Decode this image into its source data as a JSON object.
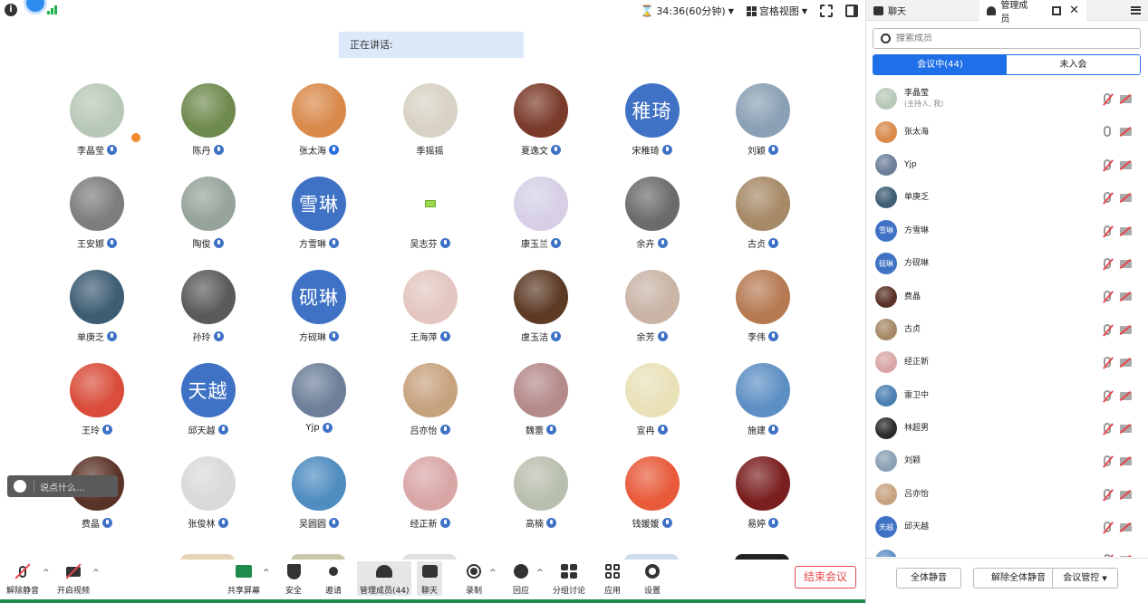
{
  "topbar": {
    "timer": "34:36(60分钟)",
    "view_mode": "宫格视图"
  },
  "speaking_label": "正在讲话:",
  "participants": [
    {
      "name": "李晶莹",
      "avatar": "photo",
      "color": "#b8c8b8",
      "host": true
    },
    {
      "name": "陈丹",
      "avatar": "photo",
      "color": "#6f8a4e"
    },
    {
      "name": "张太海",
      "avatar": "photo",
      "color": "#d9894a",
      "mic_on": true
    },
    {
      "name": "季摇摇",
      "avatar": "photo",
      "color": "#d8d2c4",
      "no_badge": true
    },
    {
      "name": "夏逸文",
      "avatar": "photo",
      "color": "#7a3b2a"
    },
    {
      "name": "宋稚琦",
      "avatar": "text",
      "text": "稚琦"
    },
    {
      "name": "刘颖",
      "avatar": "photo",
      "color": "#8aa0b4"
    },
    {
      "name": "王安娜",
      "avatar": "photo",
      "color": "#7d7d7d"
    },
    {
      "name": "陶俊",
      "avatar": "photo",
      "color": "#95a39a"
    },
    {
      "name": "方雪琳",
      "avatar": "text",
      "text": "雪琳"
    },
    {
      "name": "吴志芬",
      "avatar": "blank"
    },
    {
      "name": "康玉兰",
      "avatar": "photo",
      "color": "#d6cfe6"
    },
    {
      "name": "余卉",
      "avatar": "photo",
      "color": "#6b6b6b"
    },
    {
      "name": "古贞",
      "avatar": "photo",
      "color": "#a68966"
    },
    {
      "name": "单庚乏",
      "avatar": "photo",
      "color": "#3d5d73"
    },
    {
      "name": "孙玲",
      "avatar": "photo",
      "color": "#5a5a5a"
    },
    {
      "name": "方砚琳",
      "avatar": "text",
      "text": "砚琳"
    },
    {
      "name": "王海萍",
      "avatar": "photo",
      "color": "#e3c6c0"
    },
    {
      "name": "虞玉洁",
      "avatar": "photo",
      "color": "#5c3a24"
    },
    {
      "name": "余芳",
      "avatar": "photo",
      "color": "#c9b4a6"
    },
    {
      "name": "李伟",
      "avatar": "photo",
      "color": "#b67a53"
    },
    {
      "name": "王玲",
      "avatar": "photo",
      "color": "#d94d3a"
    },
    {
      "name": "邱天越",
      "avatar": "text",
      "text": "天越"
    },
    {
      "name": "Yjp",
      "avatar": "photo",
      "color": "#6d7f99"
    },
    {
      "name": "吕亦怡",
      "avatar": "photo",
      "color": "#c7a27f"
    },
    {
      "name": "魏蕾",
      "avatar": "photo",
      "color": "#b58a8a"
    },
    {
      "name": "宣冉",
      "avatar": "photo",
      "color": "#e9e1b8"
    },
    {
      "name": "施建",
      "avatar": "photo",
      "color": "#5d8fc4"
    },
    {
      "name": "费晶",
      "avatar": "photo",
      "color": "#5a3328"
    },
    {
      "name": "张俊林",
      "avatar": "photo",
      "color": "#d9d9d9"
    },
    {
      "name": "吴圆圆",
      "avatar": "photo",
      "color": "#4f8cc0"
    },
    {
      "name": "经正新",
      "avatar": "photo",
      "color": "#d9a6a6"
    },
    {
      "name": "高楠",
      "avatar": "photo",
      "color": "#b9bfae"
    },
    {
      "name": "钱媛媛",
      "avatar": "photo",
      "color": "#e85a3a"
    },
    {
      "name": "易婷",
      "avatar": "photo",
      "color": "#7a1f1f"
    }
  ],
  "chat_input": {
    "placeholder": "说点什么..."
  },
  "toolbar": {
    "unmute": "解除静音",
    "start_video": "开启视频",
    "share_screen": "共享屏幕",
    "security": "安全",
    "invite": "邀请",
    "manage_members": "管理成员(44)",
    "chat": "聊天",
    "record": "录制",
    "reactions": "回应",
    "breakout": "分组讨论",
    "apps": "应用",
    "settings": "设置",
    "end_meeting": "结束会议"
  },
  "panel": {
    "tab_chat": "聊天",
    "tab_members": "管理成员",
    "search_placeholder": "搜索成员",
    "seg_in_meeting": "会议中(44)",
    "seg_not_joined": "未入会",
    "members": [
      {
        "name": "李晶莹",
        "sub": "(主持人, 我)",
        "avatar": "photo",
        "color": "#b8c8b8",
        "mic_muted": true
      },
      {
        "name": "张太海",
        "avatar": "photo",
        "color": "#d9894a",
        "mic_muted": false
      },
      {
        "name": "Yjp",
        "avatar": "photo",
        "color": "#6d7f99",
        "mic_muted": true
      },
      {
        "name": "单庚乏",
        "avatar": "photo",
        "color": "#3d5d73",
        "mic_muted": true
      },
      {
        "name": "方雪琳",
        "avatar": "text",
        "text": "雪琳",
        "mic_muted": true
      },
      {
        "name": "方砚琳",
        "avatar": "text",
        "text": "砚琳",
        "mic_muted": true
      },
      {
        "name": "费晶",
        "avatar": "photo",
        "color": "#5a3328",
        "mic_muted": true
      },
      {
        "name": "古贞",
        "avatar": "photo",
        "color": "#a68966",
        "mic_muted": true
      },
      {
        "name": "经正新",
        "avatar": "photo",
        "color": "#d9a6a6",
        "mic_muted": true
      },
      {
        "name": "雷卫中",
        "avatar": "photo",
        "color": "#4a7fb0",
        "mic_muted": true
      },
      {
        "name": "林超男",
        "avatar": "photo",
        "color": "#2b2b2b",
        "mic_muted": true
      },
      {
        "name": "刘颖",
        "avatar": "photo",
        "color": "#8aa0b4",
        "mic_muted": true
      },
      {
        "name": "吕亦怡",
        "avatar": "photo",
        "color": "#c7a27f",
        "mic_muted": true
      },
      {
        "name": "邱天越",
        "avatar": "text",
        "text": "天越",
        "mic_muted": true
      },
      {
        "name": "",
        "avatar": "photo",
        "color": "#5d8fc4",
        "mic_muted": true
      }
    ],
    "btn_mute_all": "全体静音",
    "btn_unmute_all": "解除全体静音",
    "btn_controls": "会议管控"
  }
}
